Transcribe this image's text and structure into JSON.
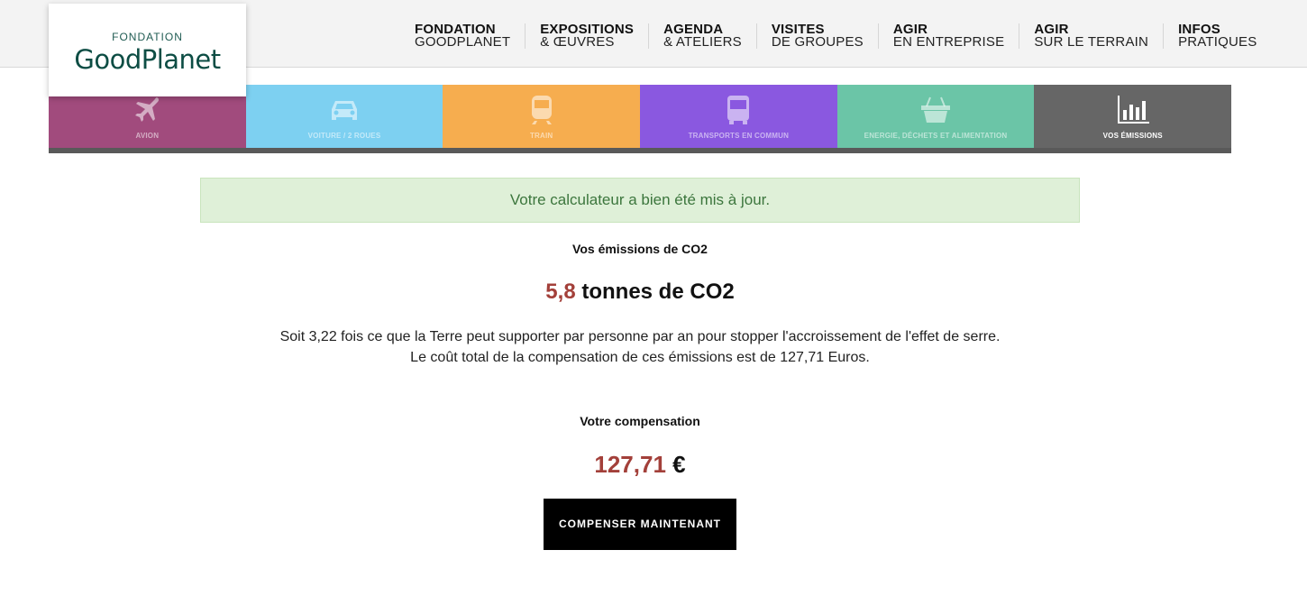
{
  "logo": {
    "small": "FONDATION",
    "big": "GoodPlanet"
  },
  "nav": [
    {
      "l1": "FONDATION",
      "l2": "GOODPLANET"
    },
    {
      "l1": "EXPOSITIONS",
      "l2": "& ŒUVRES"
    },
    {
      "l1": "AGENDA",
      "l2": "& ATELIERS"
    },
    {
      "l1": "VISITES",
      "l2": "DE GROUPES"
    },
    {
      "l1": "AGIR",
      "l2": "EN ENTREPRISE"
    },
    {
      "l1": "AGIR",
      "l2": "SUR LE TERRAIN"
    },
    {
      "l1": "INFOS",
      "l2": "PRATIQUES"
    }
  ],
  "tabs": [
    {
      "label": "AVION",
      "icon": "plane-icon",
      "color": "#a14b7d"
    },
    {
      "label": "VOITURE / 2 ROUES",
      "icon": "car-icon",
      "color": "#7dd0f1"
    },
    {
      "label": "TRAIN",
      "icon": "train-icon",
      "color": "#f6ad4f"
    },
    {
      "label": "TRANSPORTS EN COMMUN",
      "icon": "bus-icon",
      "color": "#8a58e0"
    },
    {
      "label": "ENERGIE, DÉCHETS ET ALIMENTATION",
      "icon": "basket-icon",
      "color": "#6bc5a7"
    },
    {
      "label": "VOS ÉMISSIONS",
      "icon": "bar-chart-icon",
      "color": "#666666",
      "active": true
    }
  ],
  "alert": "Votre calculateur a bien été mis à jour.",
  "emissions": {
    "heading": "Vos émissions de CO2",
    "value": "5,8",
    "unit": "tonnes de CO2",
    "line1": "Soit 3,22 fois ce que la Terre peut supporter par personne par an pour stopper l'accroissement de l'effet de serre.",
    "line2": "Le coût total de la compensation de ces émissions est de 127,71 Euros."
  },
  "compensation": {
    "heading": "Votre compensation",
    "value": "127,71",
    "currency": "€",
    "button": "COMPENSER MAINTENANT"
  }
}
